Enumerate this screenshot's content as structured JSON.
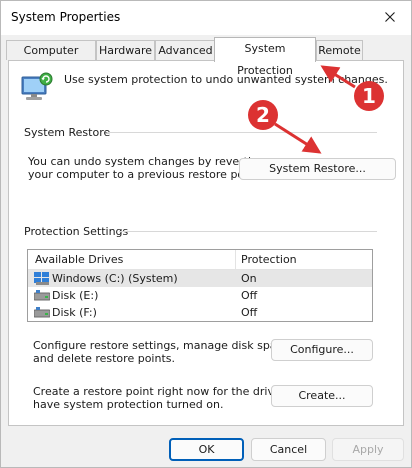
{
  "window": {
    "title": "System Properties"
  },
  "tabs": [
    {
      "label": "Computer Name"
    },
    {
      "label": "Hardware"
    },
    {
      "label": "Advanced"
    },
    {
      "label": "System Protection"
    },
    {
      "label": "Remote"
    }
  ],
  "intro": {
    "text": "Use system protection to undo unwanted system changes."
  },
  "system_restore": {
    "heading": "System Restore",
    "description_line1": "You can undo system changes by reverting",
    "description_line2": "your computer to a previous restore point.",
    "button_label": "System Restore..."
  },
  "protection_settings": {
    "heading": "Protection Settings",
    "columns": [
      "Available Drives",
      "Protection"
    ],
    "drives": [
      {
        "name": "Windows (C:) (System)",
        "protection": "On",
        "icon": "system-drive-icon"
      },
      {
        "name": "Disk (E:)",
        "protection": "Off",
        "icon": "disk-drive-icon"
      },
      {
        "name": "Disk (F:)",
        "protection": "Off",
        "icon": "disk-drive-icon"
      }
    ],
    "configure_line1": "Configure restore settings, manage disk space,",
    "configure_line2": "and delete restore points.",
    "configure_label": "Configure...",
    "create_line1": "Create a restore point right now for the drives that",
    "create_line2": "have system protection turned on.",
    "create_label": "Create..."
  },
  "footer": {
    "ok": "OK",
    "cancel": "Cancel",
    "apply": "Apply"
  },
  "annotations": [
    {
      "number": "1",
      "color": "#dc3232"
    },
    {
      "number": "2",
      "color": "#dc3232"
    }
  ]
}
